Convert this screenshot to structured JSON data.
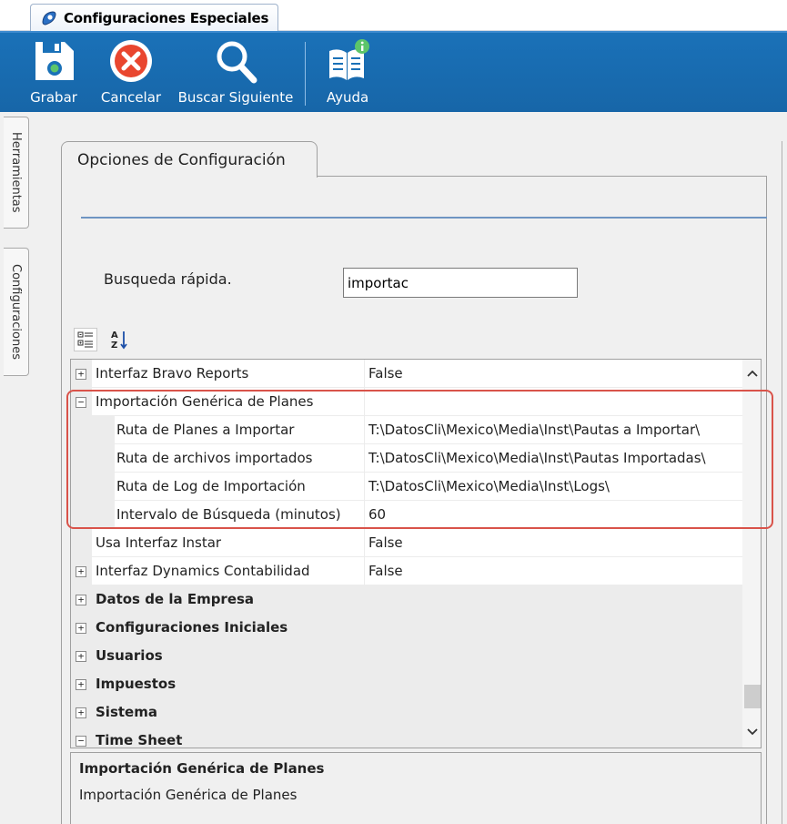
{
  "window": {
    "tab_title": "Configuraciones Especiales"
  },
  "toolbar": {
    "save_label": "Grabar",
    "cancel_label": "Cancelar",
    "find_next_label": "Buscar Siguiente",
    "help_label": "Ayuda"
  },
  "side_tabs": {
    "tools_label": "Herramientas",
    "settings_label": "Configuraciones"
  },
  "panel": {
    "tab_label": "Opciones de Configuración",
    "search_label": "Busqueda rápida.",
    "search_value": "importac"
  },
  "grid": {
    "rows": [
      {
        "name": "Interfaz Bravo Reports",
        "value": "False"
      },
      {
        "name": "Importación Genérica de Planes",
        "value": ""
      },
      {
        "name": "Ruta de Planes a Importar",
        "value": "T:\\DatosCli\\Mexico\\Media\\Inst\\Pautas a Importar\\"
      },
      {
        "name": "Ruta de archivos importados",
        "value": "T:\\DatosCli\\Mexico\\Media\\Inst\\Pautas Importadas\\"
      },
      {
        "name": "Ruta de Log de Importación",
        "value": "T:\\DatosCli\\Mexico\\Media\\Inst\\Logs\\"
      },
      {
        "name": "Intervalo de Búsqueda (minutos)",
        "value": "60"
      },
      {
        "name": "Usa Interfaz Instar",
        "value": "False"
      },
      {
        "name": "Interfaz Dynamics Contabilidad",
        "value": "False"
      },
      {
        "name": "Datos de la Empresa",
        "value": ""
      },
      {
        "name": "Configuraciones Iniciales",
        "value": ""
      },
      {
        "name": "Usuarios",
        "value": ""
      },
      {
        "name": "Impuestos",
        "value": ""
      },
      {
        "name": "Sistema",
        "value": ""
      },
      {
        "name": "Time Sheet",
        "value": ""
      }
    ]
  },
  "description": {
    "title": "Importación Genérica de Planes",
    "text": "Importación Genérica de Planes"
  },
  "colors": {
    "toolbar_blue": "#1a71b8",
    "highlight_red": "#d9534a",
    "category_gray": "#ececec"
  }
}
